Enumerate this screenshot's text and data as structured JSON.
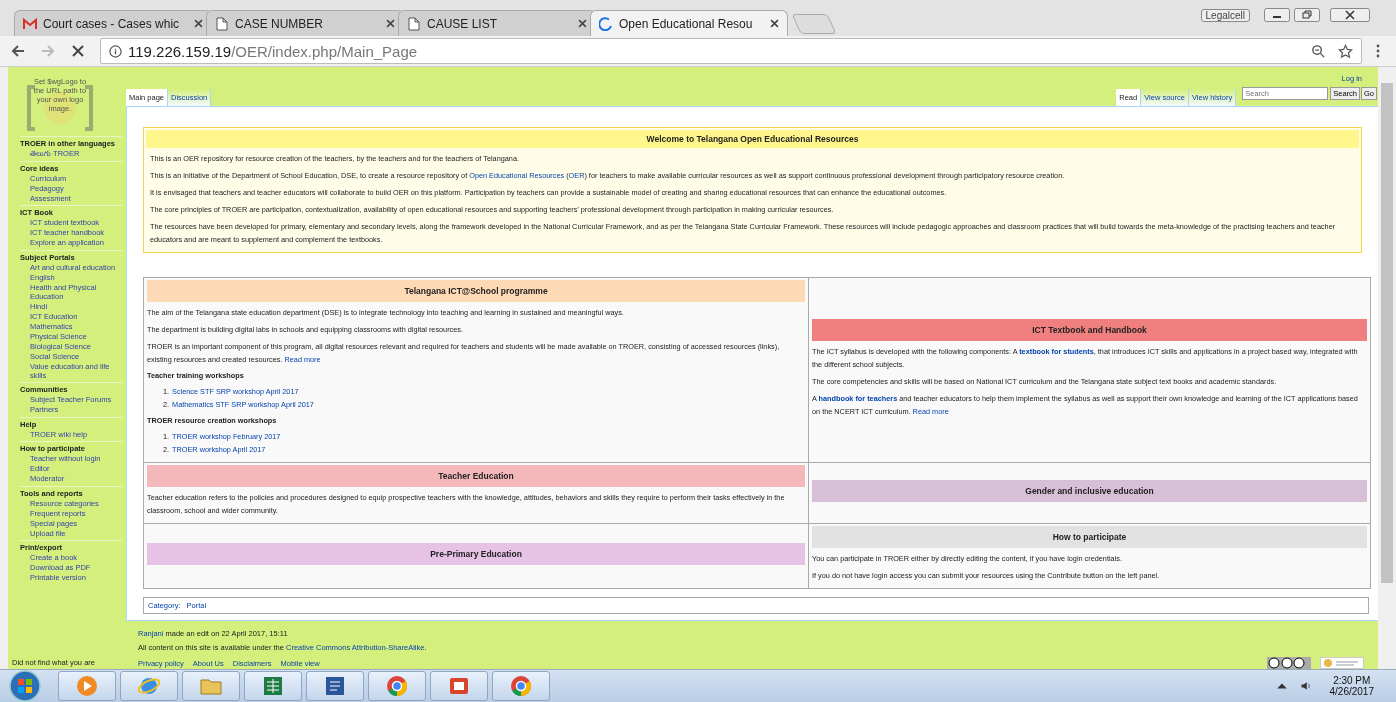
{
  "browser": {
    "tabs": [
      {
        "title": "Court cases - Cases whic",
        "selected": false
      },
      {
        "title": "CASE NUMBER",
        "selected": false
      },
      {
        "title": "CAUSE LIST",
        "selected": false
      },
      {
        "title": "Open Educational Resou",
        "selected": true
      }
    ],
    "profile": "Legalcell",
    "url_host": "119.226.159.19",
    "url_path": "/OER/index.php/Main_Page"
  },
  "logo_text": "Set $wgLogo to the URL path to your own logo image.",
  "sidebar": [
    {
      "heading": "TROER in other languages",
      "items": [
        "తెలుగు TROER"
      ]
    },
    {
      "heading": "Core ideas",
      "items": [
        "Curriculum",
        "Pedagogy",
        "Assessment"
      ]
    },
    {
      "heading": "ICT Book",
      "items": [
        "ICT student textbook",
        "ICT teacher handbook",
        "Explore an application"
      ]
    },
    {
      "heading": "Subject Portals",
      "items": [
        "Art and cultural education",
        "English",
        "Health and Physical Education",
        "Hindi",
        "ICT Education",
        "Mathematics",
        "Physical Science",
        "Biological Science",
        "Social Science",
        "Value education and life skills"
      ]
    },
    {
      "heading": "Communities",
      "items": [
        "Subject Teacher Forums",
        "Partners"
      ]
    },
    {
      "heading": "Help",
      "items": [
        "TROER wiki help"
      ]
    },
    {
      "heading": "How to participate",
      "items": [
        "Teacher without login",
        "Editor",
        "Moderator"
      ]
    },
    {
      "heading": "Tools and reports",
      "items": [
        "Resource categories",
        "Frequent reports",
        "Special pages",
        "Upload file"
      ]
    },
    {
      "heading": "Print/export",
      "items": [
        "Create a book",
        "Download as PDF",
        "Printable version"
      ]
    }
  ],
  "sidebar_note": "Did not find what you are",
  "login": "Log in",
  "left_tabs": [
    {
      "label": "Main page",
      "selected": true
    },
    {
      "label": "Discussion",
      "selected": false
    }
  ],
  "right_tabs": [
    {
      "label": "Read",
      "selected": true
    },
    {
      "label": "View source",
      "selected": false
    },
    {
      "label": "View history",
      "selected": false
    }
  ],
  "search": {
    "placeholder": "Search",
    "buttons": [
      "Search",
      "Go"
    ]
  },
  "welcome": {
    "title": "Welcome to Telangana Open Educational Resources",
    "paragraphs": [
      [
        {
          "kind": "text",
          "t": "This is an OER repository for resource creation of the teachers, by the teachers and for the teachers of Telangana."
        }
      ],
      [
        {
          "kind": "text",
          "t": "This is an initiative of the Department of School Education, DSE, to create a resource repository of "
        },
        {
          "kind": "link",
          "t": "Open Educational Resources"
        },
        {
          "kind": "text",
          "t": " ("
        },
        {
          "kind": "link",
          "t": "OER"
        },
        {
          "kind": "text",
          "t": ") for teachers to make available curricular resources as well as support continuous professional development through participatory resource creation."
        }
      ],
      [
        {
          "kind": "text",
          "t": "It is envisaged that teachers and teacher educators will collaborate to build OER on this platform. Participation by teachers can provide a sustainable model of creating and sharing educational resources that can enhance the educational outcomes."
        }
      ],
      [
        {
          "kind": "text",
          "t": "The core principles of TROER are participation, contextualization, availability of open educational resources and supporting teachers' professional development through participation in making curricular resources."
        }
      ],
      [
        {
          "kind": "text",
          "t": "The resources have been developed for primary, elementary and secondary levels, along the framework developed in the National Curricular Framework, and as per the Telangana State Curricular Framework. These resources will include pedagogic approaches and classroom practices that will build towards the meta-knowledge of the practising teachers and teacher educators and are meant to supplement and complement the textbooks."
        }
      ]
    ]
  },
  "portal_rows": [
    [
      {
        "title": "Telangana ICT@School programme",
        "color": "#fdd9b5",
        "blocks": [
          {
            "kind": "p",
            "parts": [
              {
                "kind": "text",
                "t": "The aim of the Telangana state education department (DSE) is to integrate technology into teaching and learning in sustained and meaningful ways."
              }
            ]
          },
          {
            "kind": "p",
            "parts": [
              {
                "kind": "text",
                "t": "The department is building digital labs in schools and equipping classrooms with digital resources."
              }
            ]
          },
          {
            "kind": "p",
            "parts": [
              {
                "kind": "text",
                "t": "TROER is an important component of this program, all digital resources relevant and required for teachers and students will be made available on TROER, consisting of accessed resources (links), existing resources and created resources. "
              },
              {
                "kind": "link",
                "t": "Read more"
              }
            ]
          },
          {
            "kind": "heading",
            "text": "Teacher training workshops"
          },
          {
            "kind": "list",
            "items": [
              {
                "num": "1.",
                "text": "Science STF SRP workshop April 2017"
              },
              {
                "num": "2.",
                "text": "Mathematics STF SRP workshop April 2017"
              }
            ]
          },
          {
            "kind": "heading",
            "text": "TROER resource creation workshops"
          },
          {
            "kind": "list",
            "items": [
              {
                "num": "1.",
                "text": "TROER workshop February 2017"
              },
              {
                "num": "2.",
                "text": "TROER workshop April 2017"
              }
            ]
          }
        ]
      },
      {
        "title": "ICT Textbook and Handbook",
        "color": "#f08080",
        "blocks": [
          {
            "kind": "p",
            "parts": [
              {
                "kind": "text",
                "t": "The ICT syllabus is developed with the following components: A "
              },
              {
                "kind": "bold_link",
                "t": "textbook for students"
              },
              {
                "kind": "text",
                "t": ", that introduces ICT skills and applications in a project based way, integrated with the different school subjects."
              }
            ]
          },
          {
            "kind": "p",
            "parts": [
              {
                "kind": "text",
                "t": "The core competencies and skills will be based on National ICT curriculum and the Telangana state subject text books and academic standards."
              }
            ]
          },
          {
            "kind": "p",
            "parts": [
              {
                "kind": "text",
                "t": "A "
              },
              {
                "kind": "bold_link",
                "t": "handbook for teachers"
              },
              {
                "kind": "text",
                "t": " and teacher educators to help them implement the syllabus as well as support their own knowledge and learning of the ICT applications based on the NCERT ICT curriculum. "
              },
              {
                "kind": "link",
                "t": "Read more"
              }
            ]
          }
        ]
      }
    ],
    [
      {
        "title": "Teacher Education",
        "color": "#f4b8bb",
        "blocks": [
          {
            "kind": "p",
            "parts": [
              {
                "kind": "text",
                "t": "Teacher education refers to the policies and procedures designed to equip prospective teachers with the knowledge, attitudes, behaviors and skills they require to perform their tasks effectively in the classroom, school and wider community."
              }
            ]
          }
        ]
      },
      {
        "title": "Gender and inclusive education",
        "color": "#d8bfd8"
      }
    ],
    [
      {
        "title": "Pre-Primary Education",
        "color": "#e6c3e6"
      },
      {
        "title": "How to participate",
        "color": "#e2e2e2",
        "blocks": [
          {
            "kind": "p",
            "parts": [
              {
                "kind": "text",
                "t": "You can participate in TROER either by directly editing the content, if you have login credentials."
              }
            ]
          },
          {
            "kind": "p",
            "parts": [
              {
                "kind": "text",
                "t": "If you do not have login access you can submit your resources using the Contribute button on the left panel."
              }
            ]
          }
        ]
      }
    ]
  ],
  "category": {
    "label": "Category:",
    "links": [
      "Portal"
    ]
  },
  "footer": {
    "lines": [
      [
        {
          "kind": "link",
          "t": "Ranjani"
        },
        {
          "kind": "text",
          "t": " made an edit on 22 April 2017, 15:11"
        }
      ],
      [
        {
          "kind": "text",
          "t": "All content on this site is available under the "
        },
        {
          "kind": "link",
          "t": "Creative Commons Attribution-ShareAlike"
        },
        {
          "kind": "text",
          "t": "."
        }
      ]
    ],
    "links": [
      "Privacy policy",
      "About Us",
      "Disclaimers",
      "Mobile view"
    ]
  },
  "taskbar": {
    "time": "2:30 PM",
    "date": "4/26/2017"
  }
}
